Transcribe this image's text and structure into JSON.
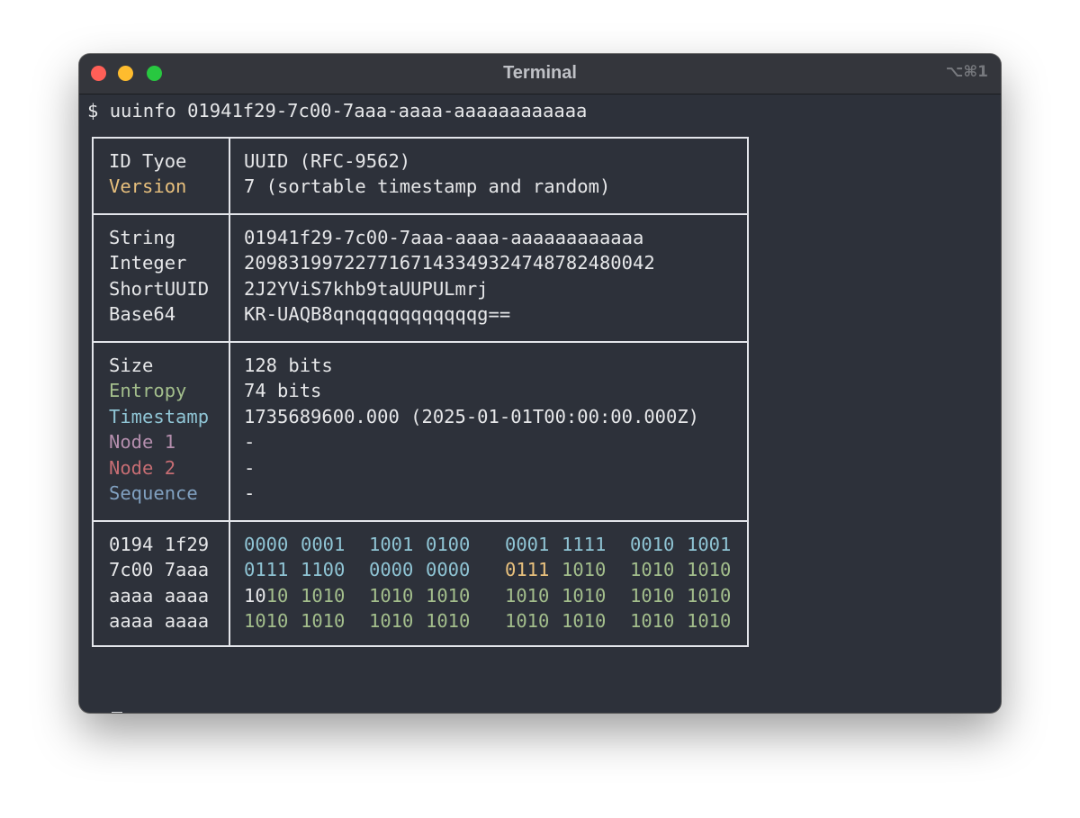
{
  "window": {
    "title": "Terminal",
    "shortcut": "⌥⌘1"
  },
  "terminal": {
    "prompt": "$",
    "command": "uuinfo 01941f29-7c00-7aaa-aaaa-aaaaaaaaaaaa"
  },
  "table": {
    "section1": {
      "labels": [
        "ID Tyoe",
        "Version"
      ],
      "values": [
        "UUID (RFC-9562)",
        "7 (sortable timestamp and random)"
      ]
    },
    "section2": {
      "labels": [
        "String",
        "Integer",
        "ShortUUID",
        "Base64"
      ],
      "values": [
        "01941f29-7c00-7aaa-aaaa-aaaaaaaaaaaa",
        "2098319972277167143349324748782480042",
        "2J2YViS7khb9taUUPULmrj",
        "KR-UAQB8qnqqqqqqqqqqqg=="
      ]
    },
    "section3": {
      "labels": [
        "Size",
        "Entropy",
        "Timestamp",
        "Node 1",
        "Node 2",
        "Sequence"
      ],
      "values": [
        "128 bits",
        "74 bits",
        "1735689600.000 (2025-01-01T00:00:00.000Z)",
        "-",
        "-",
        "-"
      ]
    },
    "section4": {
      "hex_rows": [
        "0194 1f29",
        "7c00 7aaa",
        "aaaa aaaa",
        "aaaa aaaa"
      ],
      "binary_rows": [
        [
          "0000",
          "0001",
          "1001",
          "0100",
          "0001",
          "1111",
          "0010",
          "1001"
        ],
        [
          "0111",
          "1100",
          "0000",
          "0000",
          "0111",
          "1010",
          "1010",
          "1010"
        ],
        [
          "1010",
          "1010",
          "1010",
          "1010",
          "1010",
          "1010",
          "1010",
          "1010"
        ],
        [
          "1010",
          "1010",
          "1010",
          "1010",
          "1010",
          "1010",
          "1010",
          "1010"
        ]
      ],
      "binary_split_prefix": "10",
      "binary_split_suffix": "10"
    }
  },
  "colors": {
    "version": "#e8c07d",
    "entropy": "#a3be8c",
    "timestamp": "#8fc4d4",
    "node1": "#b48ead",
    "node2": "#c66d73",
    "sequence": "#81a1c1"
  }
}
